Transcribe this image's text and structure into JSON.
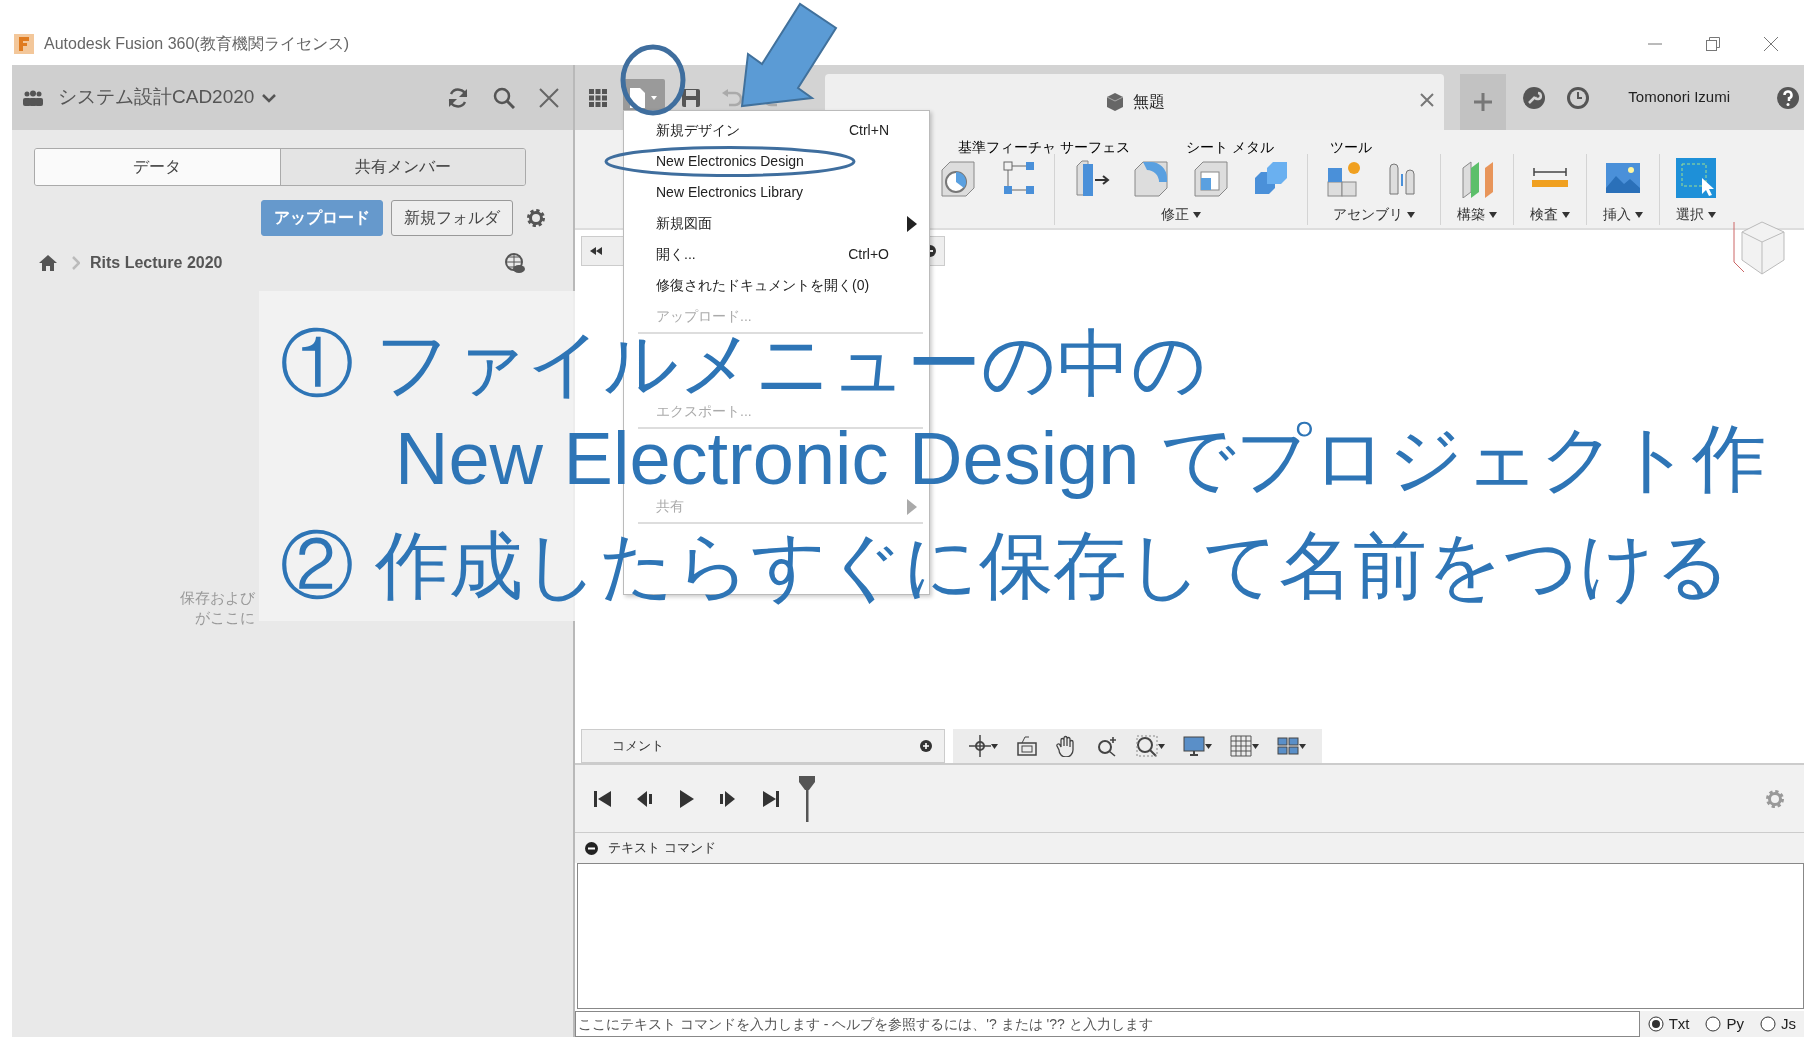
{
  "window": {
    "title": "Autodesk Fusion 360(教育機関ライセンス)"
  },
  "data_panel": {
    "project": "システム設計CAD2020",
    "tabs": [
      {
        "label": "データ",
        "selected": true
      },
      {
        "label": "共有メンバー",
        "selected": false
      }
    ],
    "buttons": [
      {
        "label": "アップロード",
        "kind": "primary"
      },
      {
        "label": "新規フォルダ",
        "kind": "secondary"
      }
    ],
    "breadcrumb": "Rits Lecture 2020",
    "empty_message": [
      "保存および",
      "がここに"
    ]
  },
  "document_tab": {
    "title": "無題"
  },
  "user": "Tomonori Izumi",
  "ribbon": {
    "tabs": [
      "基準フィーチャ サーフェス",
      "シート メタル",
      "ツール"
    ],
    "groups": [
      {
        "label": "修正"
      },
      {
        "label": "アセンブリ"
      },
      {
        "label": "構築"
      },
      {
        "label": "検査"
      },
      {
        "label": "挿入"
      },
      {
        "label": "選択"
      }
    ]
  },
  "file_menu": [
    {
      "kind": "item",
      "label": "新規デザイン",
      "shortcut": "Ctrl+N",
      "disabled": false
    },
    {
      "kind": "item",
      "label": "New Electronics Design",
      "disabled": false
    },
    {
      "kind": "item",
      "label": "New Electronics Library",
      "disabled": false
    },
    {
      "kind": "submenu",
      "label": "新規図面",
      "disabled": false
    },
    {
      "kind": "item",
      "label": "開く...",
      "shortcut": "Ctrl+O",
      "disabled": false
    },
    {
      "kind": "item",
      "label": "修復されたドキュメントを開く(0)",
      "disabled": false
    },
    {
      "kind": "item",
      "label": "アップロード...",
      "disabled": true
    },
    {
      "kind": "separator"
    },
    {
      "kind": "item"
    },
    {
      "kind": "item"
    },
    {
      "kind": "item",
      "label": "エクスポート...",
      "disabled": true
    },
    {
      "kind": "separator"
    },
    {
      "kind": "item"
    },
    {
      "kind": "item"
    },
    {
      "kind": "submenu",
      "label": "共有",
      "disabled": true
    },
    {
      "kind": "separator"
    },
    {
      "kind": "item"
    },
    {
      "kind": "item"
    }
  ],
  "comment_bar": {
    "label": "コメント"
  },
  "text_command": {
    "title": "テキスト コマンド",
    "placeholder": "ここにテキスト コマンドを入力します - ヘルプを参照するには、'? または '?? と入力します",
    "modes": [
      {
        "label": "Txt",
        "selected": true
      },
      {
        "label": "Py",
        "selected": false
      },
      {
        "label": "Js",
        "selected": false
      }
    ]
  },
  "callout": {
    "lines": [
      "① ファイルメニューの中の",
      "New Electronic Design でプロジェクト作",
      "② 作成したらすぐに保存して名前をつける"
    ]
  }
}
